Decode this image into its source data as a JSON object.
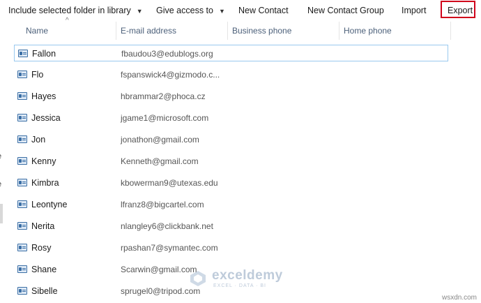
{
  "toolbar": {
    "include_folder": "Include selected folder in library",
    "give_access": "Give access to",
    "new_contact": "New Contact",
    "new_contact_group": "New Contact Group",
    "import": "Import",
    "export": "Export",
    "highlight_color": "#d0021b"
  },
  "left_pane": {
    "glyph_1": "e",
    "glyph_2": "e"
  },
  "columns": {
    "name": "Name",
    "email": "E-mail address",
    "business_phone": "Business phone",
    "home_phone": "Home phone"
  },
  "contacts": [
    {
      "name": "Fallon",
      "email": "fbaudou3@edublogs.org"
    },
    {
      "name": "Flo",
      "email": "fspanswick4@gizmodo.c..."
    },
    {
      "name": "Hayes",
      "email": "hbrammar2@phoca.cz"
    },
    {
      "name": "Jessica",
      "email": "jgame1@microsoft.com"
    },
    {
      "name": "Jon",
      "email": "jonathon@gmail.com"
    },
    {
      "name": "Kenny",
      "email": "Kenneth@gmail.com"
    },
    {
      "name": "Kimbra",
      "email": "kbowerman9@utexas.edu"
    },
    {
      "name": "Leontyne",
      "email": "lfranz8@bigcartel.com"
    },
    {
      "name": "Nerita",
      "email": "nlangley6@clickbank.net"
    },
    {
      "name": "Rosy",
      "email": "rpashan7@symantec.com"
    },
    {
      "name": "Shane",
      "email": "Scarwin@gmail.com"
    },
    {
      "name": "Sibelle",
      "email": "sprugel0@tripod.com"
    }
  ],
  "watermark": {
    "name": "exceldemy",
    "tagline": "EXCEL · DATA · BI"
  },
  "credit": "wsxdn.com"
}
